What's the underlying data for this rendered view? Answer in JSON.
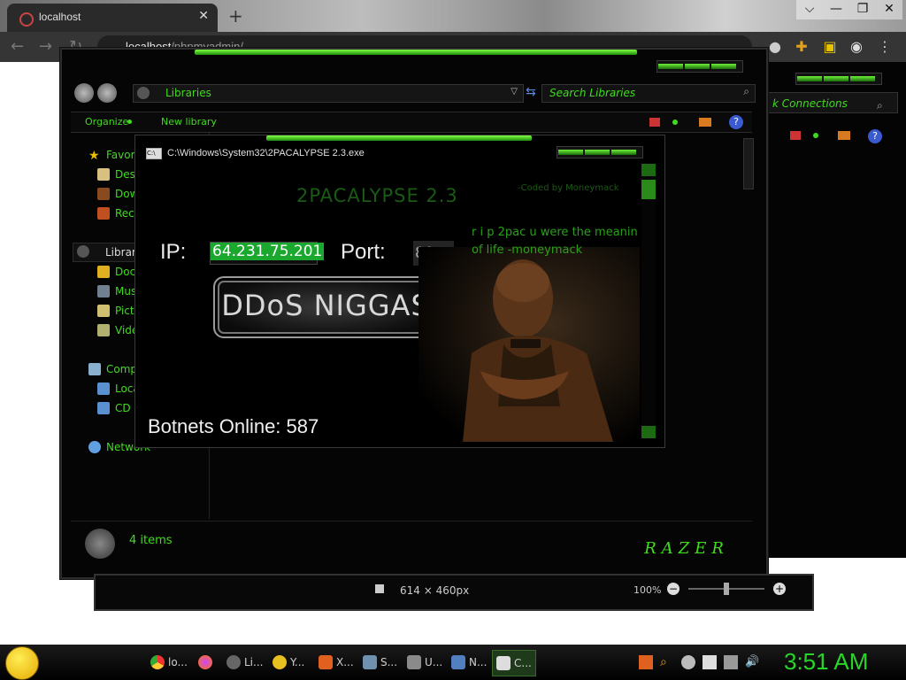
{
  "browser": {
    "tab_title": "localhost",
    "url_host": "localhost",
    "url_path": "/phpmyadmin/",
    "new_tab_symbol": "+",
    "window_controls": [
      "⌵",
      "—",
      "❐",
      "✕"
    ]
  },
  "explorer": {
    "address": "Libraries",
    "search_placeholder": "Search Libraries",
    "toolbar": {
      "organize": "Organize",
      "new_library": "New library"
    },
    "nav": {
      "favorites": "Favori",
      "desktop": "Des",
      "downloads": "Dow",
      "recent": "Rec",
      "libraries": "Librar",
      "documents": "Doc",
      "music": "Mus",
      "pictures": "Pict",
      "videos": "Vide",
      "computer": "Comp",
      "local": "Loca",
      "cd": "CD",
      "network": "Network"
    },
    "status_items": "4 items",
    "brand": "RAZER"
  },
  "back_window": {
    "label": "k Connections"
  },
  "viewer": {
    "dimensions": "614 × 460px",
    "zoom": "100%"
  },
  "cmd": {
    "title": "C:\\Windows\\System32\\2PACALYPSE 2.3.exe",
    "app_title": "2PACALYPSE  2.3",
    "coded_by": "-Coded by Moneymack",
    "ip_label": "IP:",
    "ip_value": "64.231.75.201",
    "port_label": "Port:",
    "port_value": "80",
    "button": "DDoS NIGGAS",
    "tribute_line1": "r i p 2pac u were the meanin",
    "tribute_line2": "of life -moneymack",
    "botnets": "Botnets Online: 587"
  },
  "taskbar": {
    "items": [
      {
        "label": "lo...",
        "icon": "chrome-icon"
      },
      {
        "label": "",
        "icon": "firefox-icon"
      },
      {
        "label": "Li...",
        "icon": "libraries-icon"
      },
      {
        "label": "Y...",
        "icon": "yahoo-icon"
      },
      {
        "label": "X...",
        "icon": "xampp-icon"
      },
      {
        "label": "S...",
        "icon": "services-icon"
      },
      {
        "label": "U...",
        "icon": "utility-icon"
      },
      {
        "label": "N...",
        "icon": "network-icon"
      },
      {
        "label": "C...",
        "icon": "cmd-icon"
      }
    ],
    "clock": "3:51 AM"
  },
  "colors": {
    "accent": "#3fdc1e",
    "background": "#000000"
  }
}
